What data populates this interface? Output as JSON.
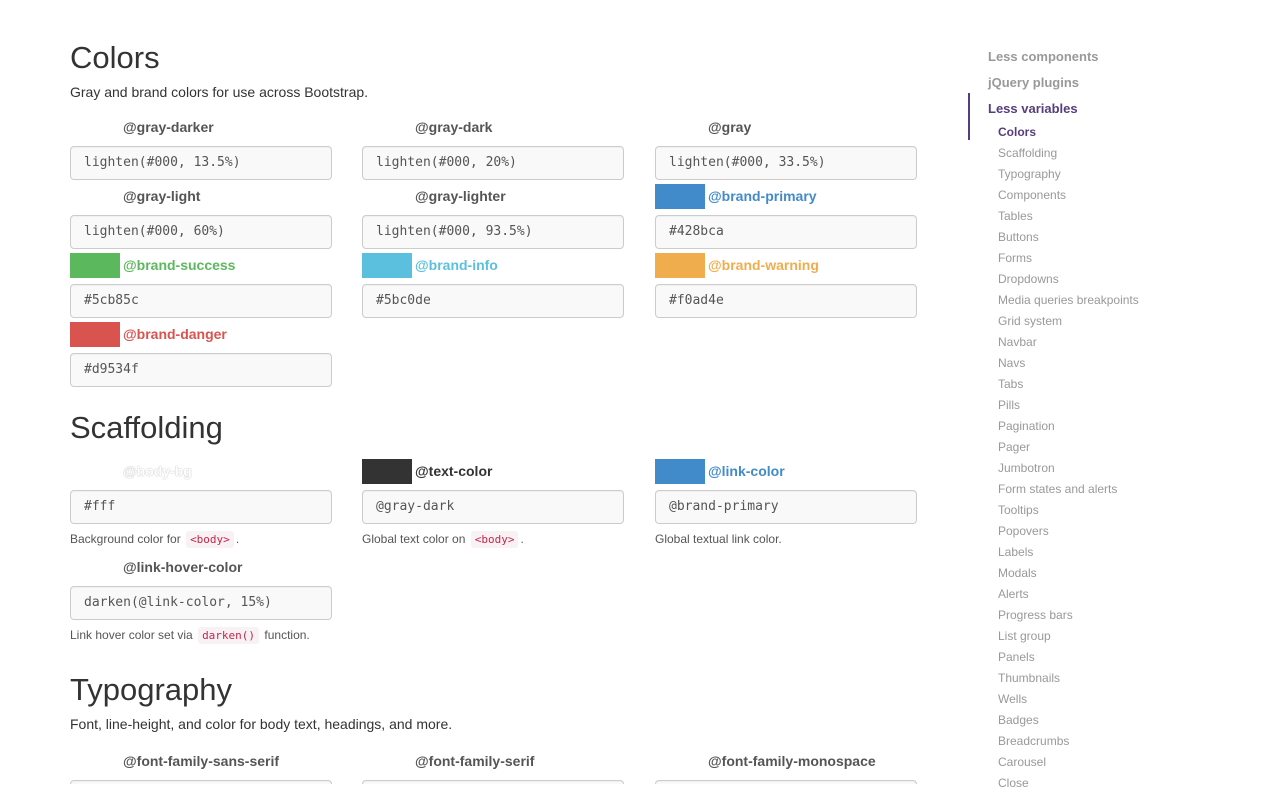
{
  "colors_section": {
    "title": "Colors",
    "lead": "Gray and brand colors for use across Bootstrap.",
    "variables": [
      {
        "name": "@gray-darker",
        "value": "lighten(#000, 13.5%)",
        "swatch": null,
        "label_color": "#555555"
      },
      {
        "name": "@gray-dark",
        "value": "lighten(#000, 20%)",
        "swatch": null,
        "label_color": "#555555"
      },
      {
        "name": "@gray",
        "value": "lighten(#000, 33.5%)",
        "swatch": null,
        "label_color": "#555555"
      },
      {
        "name": "@gray-light",
        "value": "lighten(#000, 60%)",
        "swatch": null,
        "label_color": "#555555"
      },
      {
        "name": "@gray-lighter",
        "value": "lighten(#000, 93.5%)",
        "swatch": null,
        "label_color": "#555555"
      },
      {
        "name": "@brand-primary",
        "value": "#428bca",
        "swatch": "#428bca",
        "label_color": "#428bca"
      },
      {
        "name": "@brand-success",
        "value": "#5cb85c",
        "swatch": "#5cb85c",
        "label_color": "#5cb85c"
      },
      {
        "name": "@brand-info",
        "value": "#5bc0de",
        "swatch": "#5bc0de",
        "label_color": "#5bc0de"
      },
      {
        "name": "@brand-warning",
        "value": "#f0ad4e",
        "swatch": "#f0ad4e",
        "label_color": "#f0ad4e"
      },
      {
        "name": "@brand-danger",
        "value": "#d9534f",
        "swatch": "#d9534f",
        "label_color": "#d9534f"
      }
    ]
  },
  "scaffolding_section": {
    "title": "Scaffolding",
    "variables": [
      {
        "name": "@body-bg",
        "value": "#fff",
        "label_color": "#ffffff",
        "help_prefix": "Background color for ",
        "help_code": "<body>",
        "help_suffix": "."
      },
      {
        "name": "@text-color",
        "value": "@gray-dark",
        "swatch": "#333333",
        "label_color": "#333333",
        "help_prefix": "Global text color on ",
        "help_code": "<body>",
        "help_suffix": "."
      },
      {
        "name": "@link-color",
        "value": "@brand-primary",
        "swatch": "#428bca",
        "label_color": "#428bca",
        "help_prefix": "Global textual link color.",
        "help_code": "",
        "help_suffix": ""
      },
      {
        "name": "@link-hover-color",
        "value": "darken(@link-color, 15%)",
        "label_color": "#555555",
        "help_prefix": "Link hover color set via ",
        "help_code": "darken()",
        "help_suffix": " function."
      }
    ]
  },
  "typography_section": {
    "title": "Typography",
    "lead": "Font, line-height, and color for body text, headings, and more.",
    "variables": [
      {
        "name": "@font-family-sans-serif"
      },
      {
        "name": "@font-family-serif"
      },
      {
        "name": "@font-family-monospace"
      }
    ]
  },
  "sidebar": {
    "top_items": [
      {
        "label": "Less components",
        "active": false
      },
      {
        "label": "jQuery plugins",
        "active": false
      },
      {
        "label": "Less variables",
        "active": true
      }
    ],
    "sub_items": [
      {
        "label": "Colors",
        "active": true
      },
      {
        "label": "Scaffolding"
      },
      {
        "label": "Typography"
      },
      {
        "label": "Components"
      },
      {
        "label": "Tables"
      },
      {
        "label": "Buttons"
      },
      {
        "label": "Forms"
      },
      {
        "label": "Dropdowns"
      },
      {
        "label": "Media queries breakpoints"
      },
      {
        "label": "Grid system"
      },
      {
        "label": "Navbar"
      },
      {
        "label": "Navs"
      },
      {
        "label": "Tabs"
      },
      {
        "label": "Pills"
      },
      {
        "label": "Pagination"
      },
      {
        "label": "Pager"
      },
      {
        "label": "Jumbotron"
      },
      {
        "label": "Form states and alerts"
      },
      {
        "label": "Tooltips"
      },
      {
        "label": "Popovers"
      },
      {
        "label": "Labels"
      },
      {
        "label": "Modals"
      },
      {
        "label": "Alerts"
      },
      {
        "label": "Progress bars"
      },
      {
        "label": "List group"
      },
      {
        "label": "Panels"
      },
      {
        "label": "Thumbnails"
      },
      {
        "label": "Wells"
      },
      {
        "label": "Badges"
      },
      {
        "label": "Breadcrumbs"
      },
      {
        "label": "Carousel"
      },
      {
        "label": "Close"
      }
    ],
    "accent_color": "#563d7c"
  }
}
